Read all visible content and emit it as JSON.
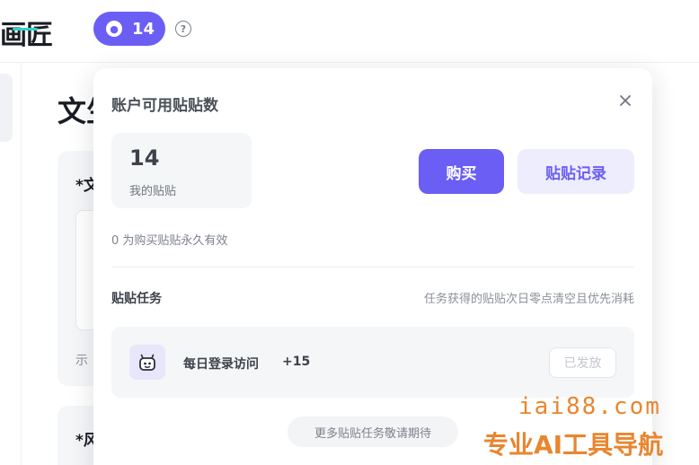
{
  "header": {
    "logo_text": "画匠",
    "credits_count": "14",
    "help_glyph": "?"
  },
  "background": {
    "title": "文生",
    "card1_label": "*文",
    "hint": "示",
    "card2_label": "*风"
  },
  "popup": {
    "title": "账户可用贴贴数",
    "balance": {
      "value": "14",
      "label": "我的贴贴"
    },
    "buy_label": "购买",
    "records_label": "贴贴记录",
    "validity_note": "0 为购买贴贴永久有效",
    "tasks": {
      "title": "贴贴任务",
      "note": "任务获得的贴贴次日零点清空且优先消耗",
      "items": [
        {
          "name": "每日登录访问",
          "reward": "+15",
          "status": "已发放"
        }
      ],
      "more_label": "更多贴贴任务敬请期待"
    }
  },
  "watermark": {
    "url": "iai88.com",
    "slogan": "专业AI工具导航"
  },
  "colors": {
    "accent": "#6b5ef5",
    "accent_light": "#eeedfd",
    "panel_bg": "#f5f6f8",
    "watermark": "#e8862f"
  }
}
